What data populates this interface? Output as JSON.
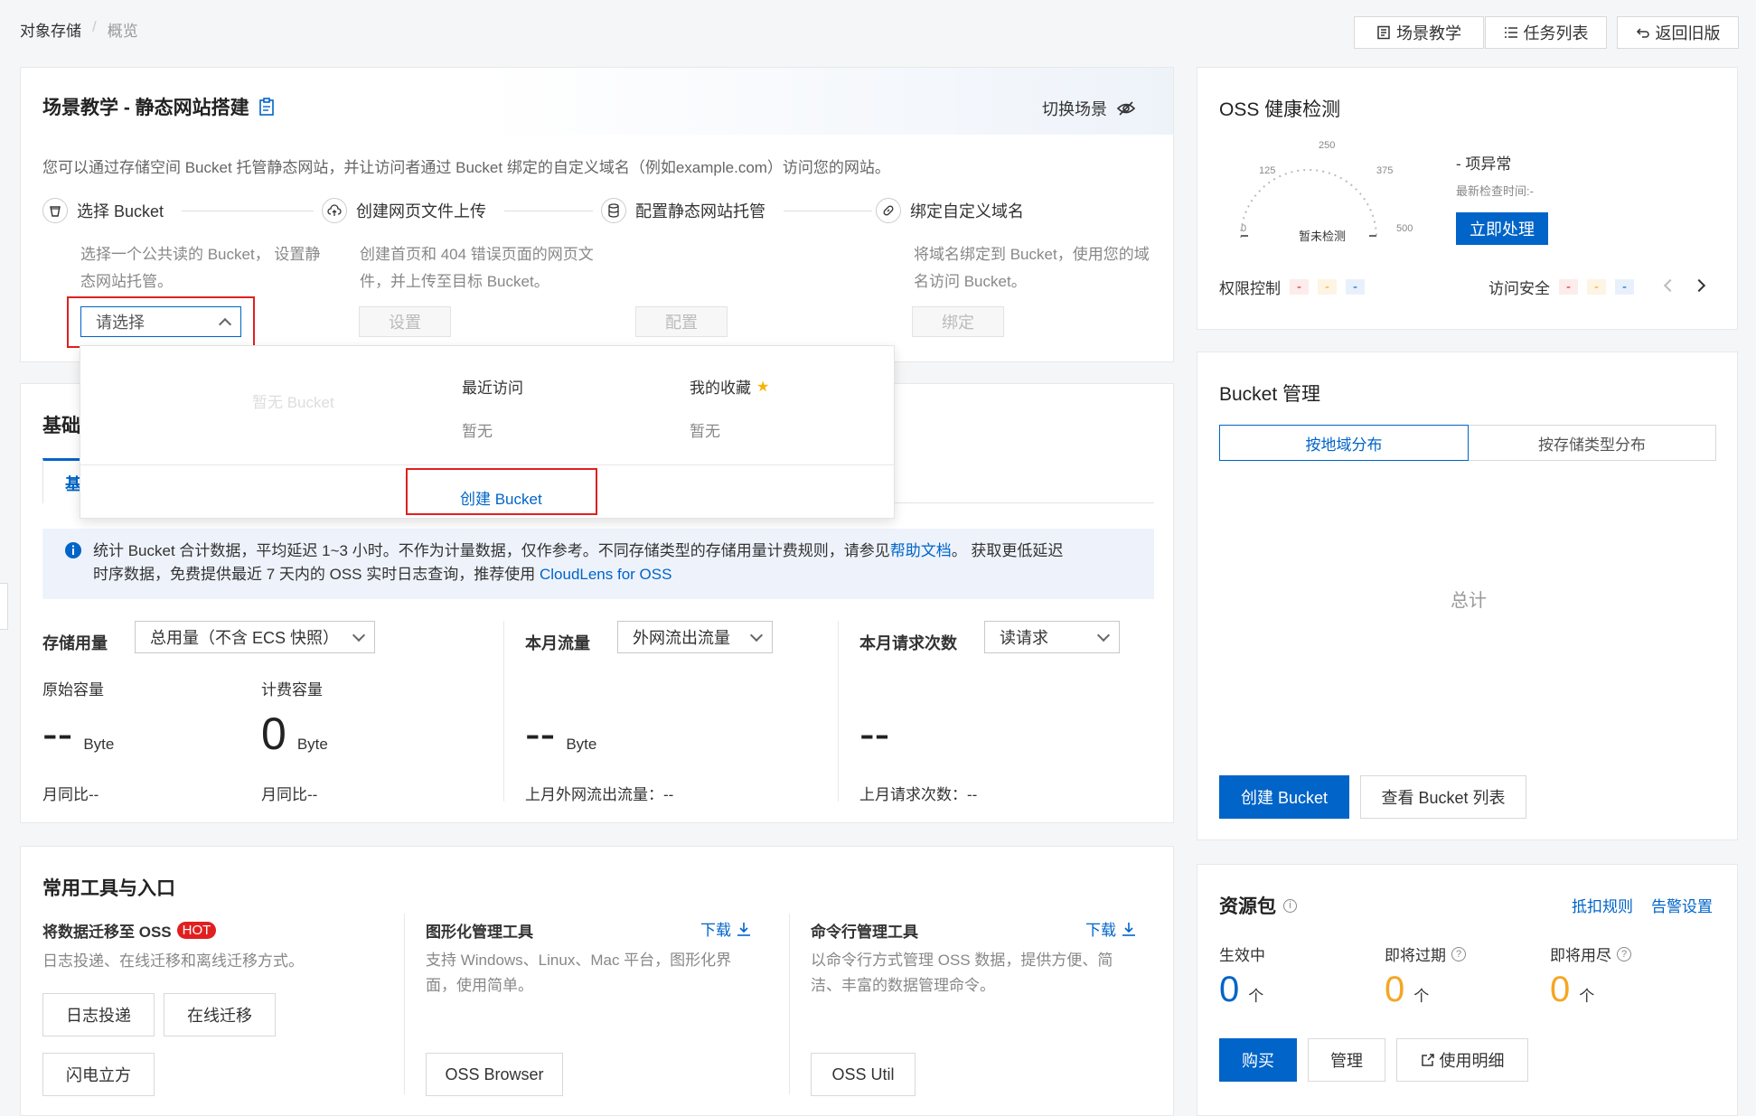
{
  "breadcrumb": {
    "root": "对象存储",
    "sep": "/",
    "current": "概览"
  },
  "top_buttons": {
    "tutorial": "场景教学",
    "tasks": "任务列表",
    "back": "返回旧版"
  },
  "scene": {
    "title": "场景教学 - 静态网站搭建",
    "switch": "切换场景",
    "desc": "您可以通过存储空间 Bucket 托管静态网站，并让访问者通过 Bucket 绑定的自定义域名（例如example.com）访问您的网站。",
    "steps": [
      {
        "title": "选择 Bucket",
        "desc": "选择一个公共读的 Bucket， 设置静态网站托管。",
        "action": "请选择"
      },
      {
        "title": "创建网页文件上传",
        "desc": "创建首页和 404 错误页面的网页文件，并上传至目标 Bucket。",
        "action": "设置"
      },
      {
        "title": "配置静态网站托管",
        "desc": "",
        "action": "配置"
      },
      {
        "title": "绑定自定义域名",
        "desc": "将域名绑定到 Bucket，使用您的域名访问 Bucket。",
        "action": "绑定"
      }
    ]
  },
  "dropdown": {
    "empty": "暂无 Bucket",
    "recent_title": "最近访问",
    "recent_value": "暂无",
    "fav_title": "我的收藏",
    "fav_value": "暂无",
    "create": "创建 Bucket"
  },
  "basic": {
    "title_partial": "基础",
    "tab_partial": "基",
    "notice": "统计 Bucket 合计数据，平均延迟 1~3 小时。不作为计量数据，仅作参考。不同存储类型的存储用量计费规则，请参见",
    "notice_link": "帮助文档",
    "notice_tail": "。 获取更低延迟",
    "notice_line2": "时序数据，免费提供最近 7 天内的 OSS 实时日志查询，推荐使用",
    "notice_link2": "CloudLens for OSS",
    "storage_label": "存储用量",
    "storage_select": "总用量（不含 ECS 快照）",
    "raw_label": "原始容量",
    "raw_value": "--",
    "raw_unit": "Byte",
    "raw_mom": "月同比--",
    "billed_label": "计费容量",
    "billed_value": "0",
    "billed_unit": "Byte",
    "billed_mom": "月同比--",
    "traffic_label": "本月流量",
    "traffic_select": "外网流出流量",
    "traffic_value": "--",
    "traffic_unit": "Byte",
    "traffic_last": "上月外网流出流量：--",
    "req_label": "本月请求次数",
    "req_select": "读请求",
    "req_value": "--",
    "req_last": "上月请求次数：--"
  },
  "tools": {
    "title": "常用工具与入口",
    "migrate_title": "将数据迁移至 OSS",
    "hot": "HOT",
    "migrate_desc": "日志投递、在线迁移和离线迁移方式。",
    "migrate_btns": [
      "日志投递",
      "在线迁移",
      "闪电立方"
    ],
    "gui_title": "图形化管理工具",
    "gui_download": "下载",
    "gui_desc1": "支持 Windows、Linux、Mac 平台，图形化界",
    "gui_desc2": "面，使用简单。",
    "gui_btn": "OSS Browser",
    "cli_title": "命令行管理工具",
    "cli_download": "下载",
    "cli_desc1": "以命令行方式管理 OSS 数据，提供方便、简",
    "cli_desc2": "洁、丰富的数据管理命令。",
    "cli_btn": "OSS Util"
  },
  "health": {
    "title": "OSS 健康检测",
    "gauge_ticks": [
      "0",
      "125",
      "250",
      "375",
      "500"
    ],
    "gauge_center": "暂未检测",
    "abnormal": "- 项异常",
    "last_check": "最新检查时间:-",
    "fix_btn": "立即处理",
    "perm_label": "权限控制",
    "perm_values": [
      "-",
      "-",
      "-"
    ],
    "access_label": "访问安全",
    "access_values": [
      "-",
      "-",
      "-"
    ]
  },
  "bucket_mgmt": {
    "title": "Bucket 管理",
    "tab_region": "按地域分布",
    "tab_type": "按存储类型分布",
    "total": "总计",
    "create_btn": "创建 Bucket",
    "list_btn": "查看 Bucket 列表"
  },
  "resource": {
    "title": "资源包",
    "deduct": "抵扣规则",
    "alert": "告警设置",
    "active_label": "生效中",
    "active_value": "0",
    "expire_label": "即将过期",
    "expire_value": "0",
    "exhaust_label": "即将用尽",
    "exhaust_value": "0",
    "unit": "个",
    "buy": "购买",
    "manage": "管理",
    "detail": "使用明细"
  },
  "colors": {
    "primary": "#0064c8",
    "danger": "#e02020",
    "warn": "#f5a623",
    "hot": "#e02020"
  }
}
